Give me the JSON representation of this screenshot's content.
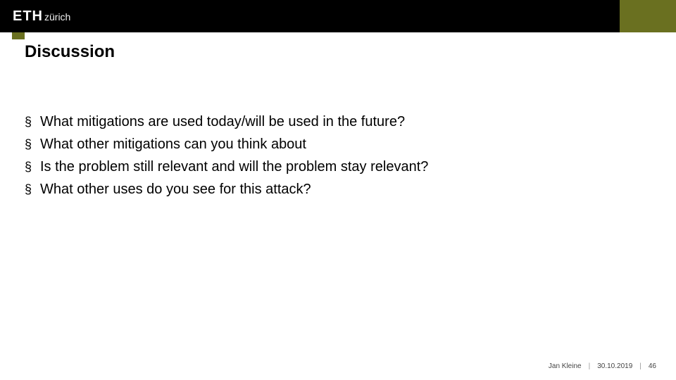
{
  "brand": {
    "eth": "ETH",
    "zurich": "zürich"
  },
  "title": "Discussion",
  "bullet_glyph": "§",
  "bullets": [
    "What mitigations are used today/will be used in the future?",
    "What other mitigations can you think about",
    "Is the problem still relevant and will the problem stay relevant?",
    "What other uses do you see for this attack?"
  ],
  "footer": {
    "author": "Jan Kleine",
    "date": "30.10.2019",
    "page": "46",
    "separator": "|"
  },
  "colors": {
    "olive": "#6a7020",
    "black": "#000000"
  }
}
